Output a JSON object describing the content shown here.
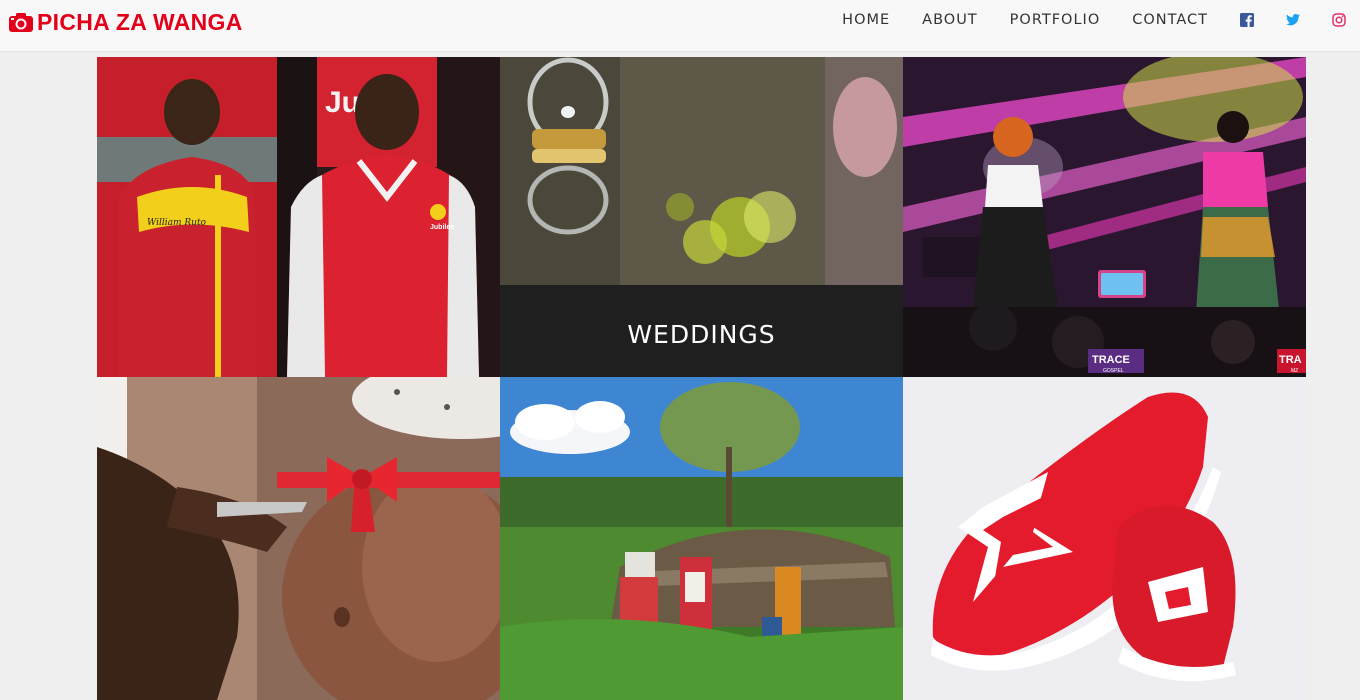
{
  "site": {
    "brand": "PICHA ZA WANGA",
    "brand_color": "#e3001b",
    "brand_icon": "camera-icon"
  },
  "nav": {
    "items": [
      {
        "label": "HOME"
      },
      {
        "label": "ABOUT"
      },
      {
        "label": "PORTFOLIO"
      },
      {
        "label": "CONTACT"
      }
    ],
    "social": [
      {
        "icon": "facebook-icon",
        "color": "#3b5998"
      },
      {
        "icon": "twitter-icon",
        "color": "#1da1f2"
      },
      {
        "icon": "instagram-icon",
        "color": "#e1306c"
      }
    ]
  },
  "gallery": {
    "tiles": [
      {
        "subject": "political-rally"
      },
      {
        "subject": "wedding-rings",
        "overlay_label": "WEDDINGS"
      },
      {
        "subject": "gospel-concert",
        "signage": [
          "TRACE",
          "GOSPEL",
          "TRA",
          "MZ"
        ]
      },
      {
        "subject": "maternity"
      },
      {
        "subject": "maasai-village"
      },
      {
        "subject": "red-sneakers"
      }
    ],
    "photo_text": {
      "jersey_name": "William Ruto",
      "jacket_badge": "Jubilee",
      "backdrop": "Ju"
    }
  }
}
